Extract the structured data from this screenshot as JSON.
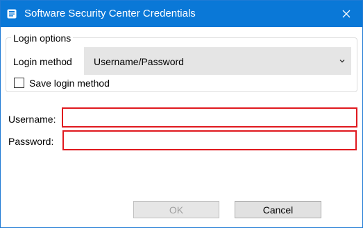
{
  "window": {
    "title": "Software Security Center Credentials",
    "titlebar_color": "#0a78d7",
    "app_icon": "app-window-icon",
    "close_icon": "close-icon"
  },
  "login_options": {
    "legend": "Login options",
    "method_label": "Login method",
    "method_value": "Username/Password",
    "dropdown_icon": "chevron-down-icon",
    "save_method_label": "Save login method",
    "save_method_checked": false
  },
  "credentials": {
    "username_label": "Username:",
    "username_value": "",
    "password_label": "Password:",
    "password_value": "",
    "invalid_border_color": "#e0181e"
  },
  "buttons": {
    "ok_label": "OK",
    "ok_enabled": false,
    "cancel_label": "Cancel"
  }
}
